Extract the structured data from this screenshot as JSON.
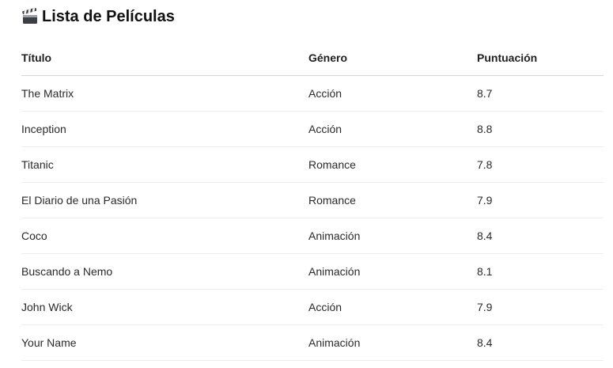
{
  "page": {
    "title_icon": "clapperboard-icon",
    "title": "Lista de Películas"
  },
  "table": {
    "headers": {
      "title": "Título",
      "genre": "Género",
      "score": "Puntuación"
    },
    "rows": [
      {
        "title": "The Matrix",
        "genre": "Acción",
        "score": "8.7"
      },
      {
        "title": "Inception",
        "genre": "Acción",
        "score": "8.8"
      },
      {
        "title": "Titanic",
        "genre": "Romance",
        "score": "7.8"
      },
      {
        "title": "El Diario de una Pasión",
        "genre": "Romance",
        "score": "7.9"
      },
      {
        "title": "Coco",
        "genre": "Animación",
        "score": "8.4"
      },
      {
        "title": "Buscando a Nemo",
        "genre": "Animación",
        "score": "8.1"
      },
      {
        "title": "John Wick",
        "genre": "Acción",
        "score": "7.9"
      },
      {
        "title": "Your Name",
        "genre": "Animación",
        "score": "8.4"
      }
    ]
  }
}
